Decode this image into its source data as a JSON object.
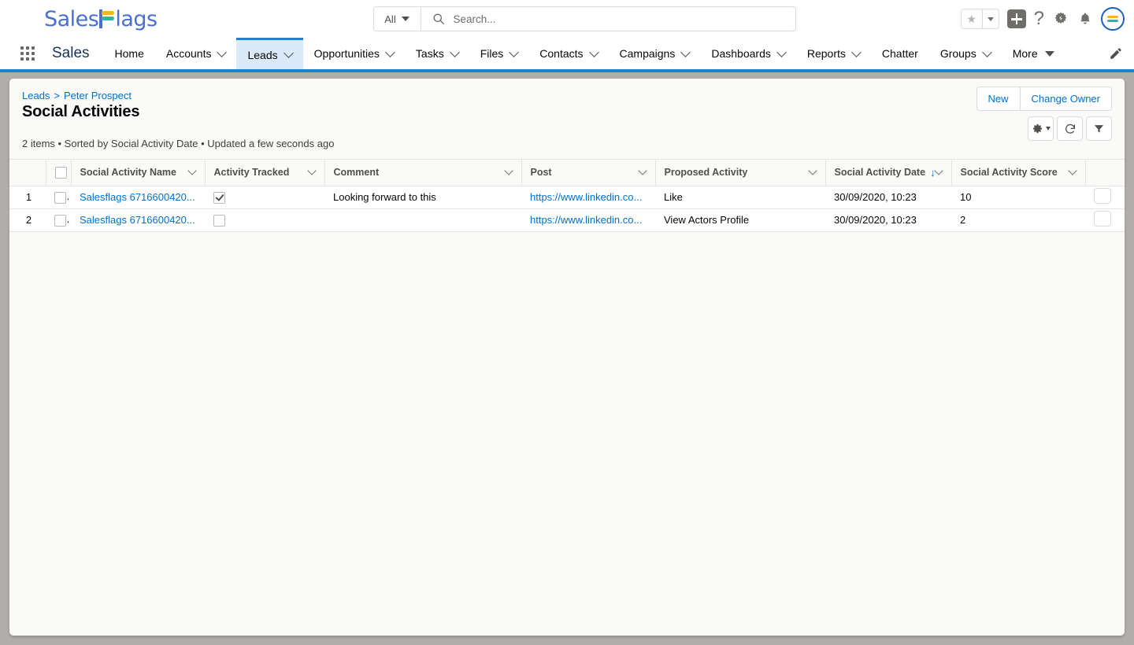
{
  "brand": {
    "logo_text_1": "Sales",
    "logo_text_2": "lags",
    "accent_blue": "#4a6fd4",
    "accent_yellow": "#f5b51e",
    "accent_teal": "#27b8a8",
    "link_blue": "#0070d2",
    "nav_active_blue": "#1e7fd4"
  },
  "header": {
    "search_scope": "All",
    "search_placeholder": "Search...",
    "search_value": "",
    "icons": [
      {
        "name": "favorites-star-icon",
        "glyph": "★"
      },
      {
        "name": "favorites-dropdown-icon"
      },
      {
        "name": "add-icon"
      },
      {
        "name": "help-icon",
        "glyph": "?"
      },
      {
        "name": "setup-gear-icon"
      },
      {
        "name": "notifications-bell-icon"
      },
      {
        "name": "user-avatar"
      }
    ]
  },
  "nav": {
    "app_launcher": "app-launcher-icon",
    "app_name": "Sales",
    "edit_icon": "pencil-icon",
    "items": [
      {
        "label": "Home",
        "has_chevron": false,
        "active": false
      },
      {
        "label": "Accounts",
        "has_chevron": true,
        "active": false
      },
      {
        "label": "Leads",
        "has_chevron": true,
        "active": true
      },
      {
        "label": "Opportunities",
        "has_chevron": true,
        "active": false
      },
      {
        "label": "Tasks",
        "has_chevron": true,
        "active": false
      },
      {
        "label": "Files",
        "has_chevron": true,
        "active": false
      },
      {
        "label": "Contacts",
        "has_chevron": true,
        "active": false
      },
      {
        "label": "Campaigns",
        "has_chevron": true,
        "active": false
      },
      {
        "label": "Dashboards",
        "has_chevron": true,
        "active": false
      },
      {
        "label": "Reports",
        "has_chevron": true,
        "active": false
      },
      {
        "label": "Chatter",
        "has_chevron": false,
        "active": false
      },
      {
        "label": "Groups",
        "has_chevron": true,
        "active": false
      },
      {
        "label": "More",
        "has_chevron": false,
        "has_triangle": true,
        "active": false
      }
    ]
  },
  "page": {
    "breadcrumb_parent": "Leads",
    "breadcrumb_separator": ">",
    "breadcrumb_current": "Peter Prospect",
    "title": "Social Activities",
    "list_meta": "2 items • Sorted by Social Activity Date • Updated a few seconds ago",
    "buttons": [
      {
        "label": "New",
        "name": "new-button"
      },
      {
        "label": "Change Owner",
        "name": "change-owner-button"
      }
    ],
    "icon_buttons": [
      {
        "name": "list-view-settings-gear-button"
      },
      {
        "name": "refresh-button"
      },
      {
        "name": "filter-button"
      }
    ]
  },
  "table": {
    "columns": [
      {
        "label": "Social Activity Name",
        "sorted": false
      },
      {
        "label": "Activity Tracked",
        "sorted": false
      },
      {
        "label": "Comment",
        "sorted": false
      },
      {
        "label": "Post",
        "sorted": false
      },
      {
        "label": "Proposed Activity",
        "sorted": false
      },
      {
        "label": "Social Activity Date",
        "sorted": true,
        "sort_dir": "↓"
      },
      {
        "label": "Social Activity Score",
        "sorted": false
      }
    ],
    "rows": [
      {
        "index": "1",
        "selected": false,
        "name": "Salesflags 6716600420...",
        "activity_tracked": true,
        "comment": "Looking forward to this",
        "post": "https://www.linkedin.co...",
        "proposed_activity": "Like",
        "date": "30/09/2020, 10:23",
        "score": "10"
      },
      {
        "index": "2",
        "selected": false,
        "name": "Salesflags 6716600420...",
        "activity_tracked": false,
        "comment": "",
        "post": "https://www.linkedin.co...",
        "proposed_activity": "View Actors Profile",
        "date": "30/09/2020, 10:23",
        "score": "2"
      }
    ]
  }
}
